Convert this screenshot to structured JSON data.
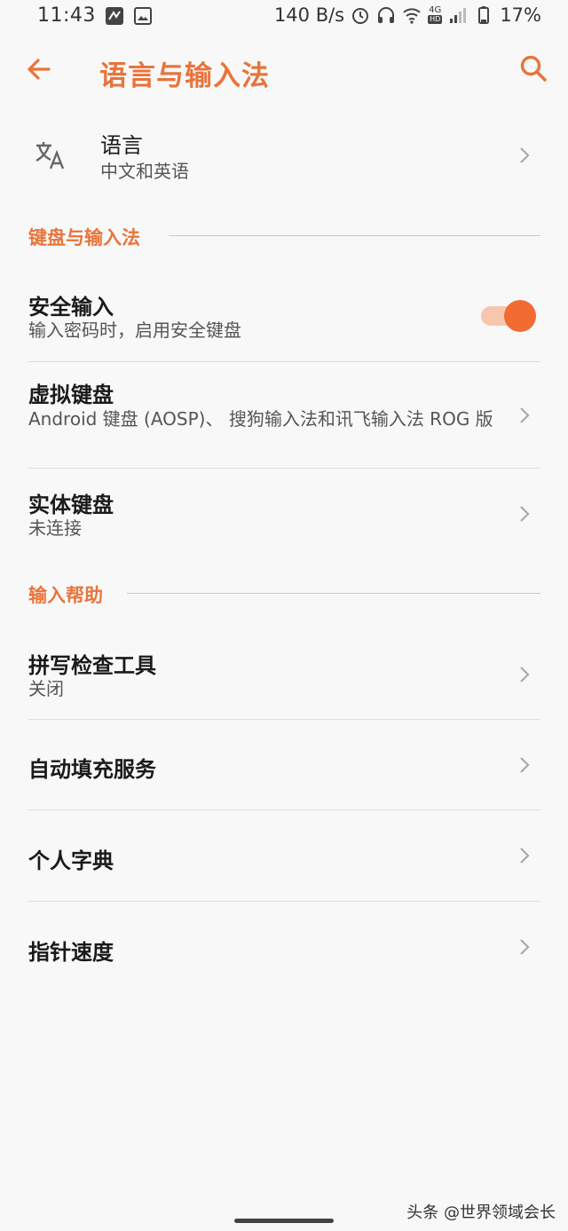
{
  "status_bar": {
    "time": "11:43",
    "speed": "140 B/s",
    "network": "4G",
    "hd": "HD",
    "battery": "17%"
  },
  "header": {
    "title": "语言与输入法",
    "back_icon": "arrow-left-icon",
    "search_icon": "search-icon"
  },
  "language": {
    "title": "语言",
    "subtitle": "中文和英语",
    "icon": "translate-icon"
  },
  "sections": {
    "keyboard": "键盘与输入法",
    "assist": "输入帮助"
  },
  "secure_input": {
    "title": "安全输入",
    "subtitle": "输入密码时，启用安全键盘",
    "enabled": true
  },
  "virtual_keyboard": {
    "title": "虚拟键盘",
    "subtitle": "Android 键盘 (AOSP)、 搜狗输入法和讯飞输入法 ROG 版"
  },
  "physical_keyboard": {
    "title": "实体键盘",
    "subtitle": "未连接"
  },
  "spell_checker": {
    "title": "拼写检查工具",
    "subtitle": "关闭"
  },
  "autofill": {
    "title": "自动填充服务"
  },
  "personal_dictionary": {
    "title": "个人字典"
  },
  "pointer_speed": {
    "title": "指针速度"
  },
  "watermark": "头条 @世界领域会长",
  "colors": {
    "accent": "#e8743b",
    "toggle_knob": "#f26b32",
    "toggle_track": "#f6c7ad"
  }
}
